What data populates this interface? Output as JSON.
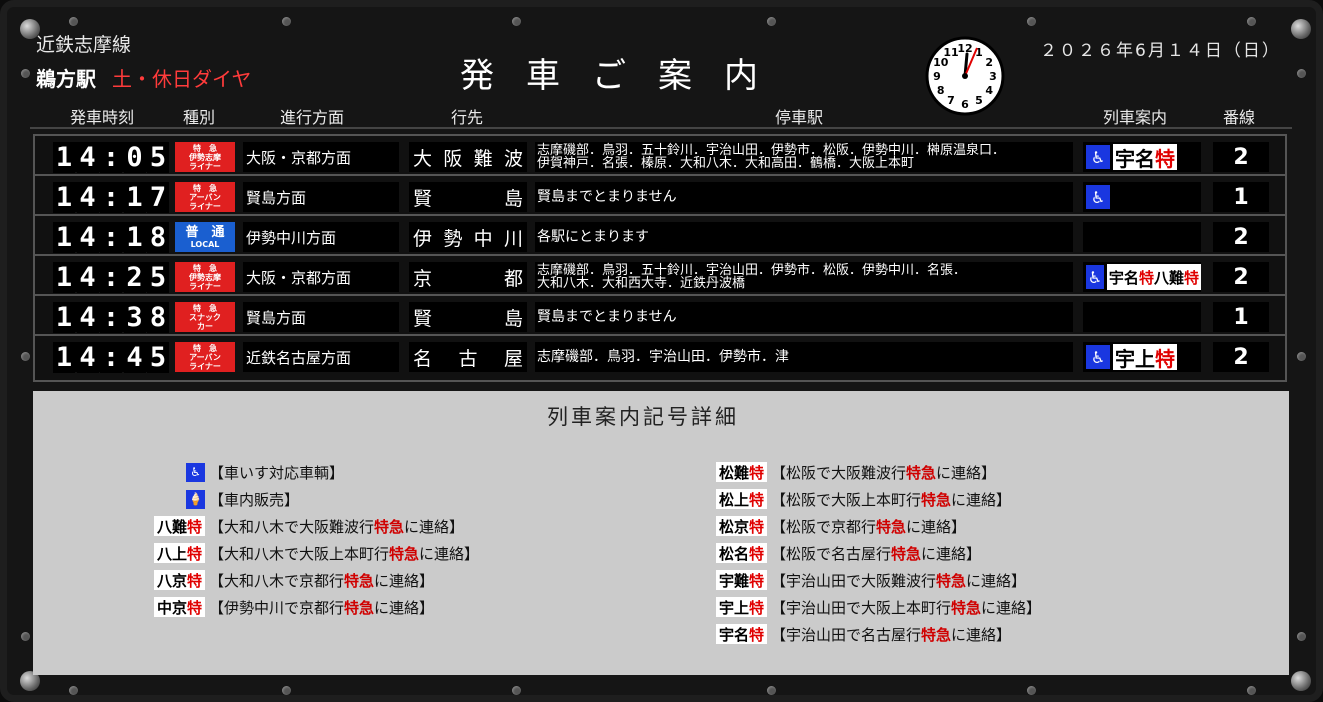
{
  "header": {
    "line_name": "近鉄志摩線",
    "station": "鵜方駅",
    "diagram": "土・休日ダイヤ",
    "title": "発車ご案内",
    "date": "２０２６年6月１４日（日）",
    "clock_numbers": [
      "12",
      "1",
      "2",
      "3",
      "4",
      "5",
      "6",
      "7",
      "8",
      "9",
      "10",
      "11"
    ]
  },
  "columns": {
    "time": "発車時刻",
    "type": "種別",
    "direction": "進行方面",
    "destination": "行先",
    "stops": "停車駅",
    "info": "列車案内",
    "track": "番線"
  },
  "departures": [
    {
      "time": [
        "1",
        "4",
        ":",
        "0",
        "5"
      ],
      "type_lines": [
        "特　急",
        "伊勢志摩",
        "ライナー"
      ],
      "type_color": "#e02020",
      "direction": "大阪・京都方面",
      "destination": [
        "大",
        "阪",
        "難",
        "波"
      ],
      "stops": [
        "志摩磯部．鳥羽．五十鈴川．宇治山田．伊勢市．松阪．伊勢中川．榊原温泉口．",
        "伊賀神戸．名張．榛原．大和八木．大和高田．鶴橋．大阪上本町"
      ],
      "wheelchair": true,
      "badge": [
        "宇",
        "名",
        "特"
      ],
      "track": "2"
    },
    {
      "time": [
        "1",
        "4",
        ":",
        "1",
        "7"
      ],
      "type_lines": [
        "特　急",
        "アーバン",
        "ライナー"
      ],
      "type_color": "#e02020",
      "direction": "賢島方面",
      "destination": [
        "賢",
        "島"
      ],
      "stops": [
        "賢島までとまりません"
      ],
      "wheelchair": true,
      "badge": [],
      "track": "1"
    },
    {
      "time": [
        "1",
        "4",
        ":",
        "1",
        "8"
      ],
      "type_lines": [
        "普　通",
        "LOCAL"
      ],
      "type_color": "#1a5fd0",
      "direction": "伊勢中川方面",
      "destination": [
        "伊",
        "勢",
        "中",
        "川"
      ],
      "stops": [
        "各駅にとまります"
      ],
      "wheelchair": false,
      "badge": [],
      "track": "2"
    },
    {
      "time": [
        "1",
        "4",
        ":",
        "2",
        "5"
      ],
      "type_lines": [
        "特　急",
        "伊勢志摩",
        "ライナー"
      ],
      "type_color": "#e02020",
      "direction": "大阪・京都方面",
      "destination": [
        "京",
        "都"
      ],
      "stops": [
        "志摩磯部．鳥羽．五十鈴川．宇治山田．伊勢市．松阪．伊勢中川．名張．",
        "大和八木．大和西大寺．近鉄丹波橋"
      ],
      "wheelchair": true,
      "badge": [
        "宇",
        "名",
        "特",
        "八",
        "難",
        "特"
      ],
      "track": "2"
    },
    {
      "time": [
        "1",
        "4",
        ":",
        "3",
        "8"
      ],
      "type_lines": [
        "特　急",
        "スナック",
        "カー"
      ],
      "type_color": "#e02020",
      "direction": "賢島方面",
      "destination": [
        "賢",
        "島"
      ],
      "stops": [
        "賢島までとまりません"
      ],
      "wheelchair": false,
      "badge": [],
      "track": "1"
    },
    {
      "time": [
        "1",
        "4",
        ":",
        "4",
        "5"
      ],
      "type_lines": [
        "特　急",
        "アーバン",
        "ライナー"
      ],
      "type_color": "#e02020",
      "direction": "近鉄名古屋方面",
      "destination": [
        "名",
        "古",
        "屋"
      ],
      "stops": [
        "志摩磯部．鳥羽．宇治山田．伊勢市．津"
      ],
      "wheelchair": true,
      "badge": [
        "宇",
        "上",
        "特"
      ],
      "track": "2"
    }
  ],
  "legend": {
    "title": "列車案内記号詳細",
    "left": [
      {
        "symbol": "wheelchair-icon",
        "pre": "【車いす対応車輌】",
        "mid": "",
        "post": ""
      },
      {
        "symbol": "vending-icon",
        "pre": "【車内販売】",
        "mid": "",
        "post": ""
      },
      {
        "symbol": [
          "八",
          "難",
          "特"
        ],
        "pre": "【大和八木で大阪難波行",
        "mid": "特急",
        "post": "に連絡】"
      },
      {
        "symbol": [
          "八",
          "上",
          "特"
        ],
        "pre": "【大和八木で大阪上本町行",
        "mid": "特急",
        "post": "に連絡】"
      },
      {
        "symbol": [
          "八",
          "京",
          "特"
        ],
        "pre": "【大和八木で京都行",
        "mid": "特急",
        "post": "に連絡】"
      },
      {
        "symbol": [
          "中",
          "京",
          "特"
        ],
        "pre": "【伊勢中川で京都行",
        "mid": "特急",
        "post": "に連絡】"
      }
    ],
    "right": [
      {
        "symbol": [
          "松",
          "難",
          "特"
        ],
        "pre": "【松阪で大阪難波行",
        "mid": "特急",
        "post": "に連絡】"
      },
      {
        "symbol": [
          "松",
          "上",
          "特"
        ],
        "pre": "【松阪で大阪上本町行",
        "mid": "特急",
        "post": "に連絡】"
      },
      {
        "symbol": [
          "松",
          "京",
          "特"
        ],
        "pre": "【松阪で京都行",
        "mid": "特急",
        "post": "に連絡】"
      },
      {
        "symbol": [
          "松",
          "名",
          "特"
        ],
        "pre": "【松阪で名古屋行",
        "mid": "特急",
        "post": "に連絡】"
      },
      {
        "symbol": [
          "宇",
          "難",
          "特"
        ],
        "pre": "【宇治山田で大阪難波行",
        "mid": "特急",
        "post": "に連絡】"
      },
      {
        "symbol": [
          "宇",
          "上",
          "特"
        ],
        "pre": "【宇治山田で大阪上本町行",
        "mid": "特急",
        "post": "に連絡】"
      },
      {
        "symbol": [
          "宇",
          "名",
          "特"
        ],
        "pre": "【宇治山田で名古屋行",
        "mid": "特急",
        "post": "に連絡】"
      }
    ]
  },
  "colors": {
    "express_red": "#e00000",
    "wheelchair_blue": "#1a37e0",
    "legend_bg": "#cbcbcb"
  }
}
